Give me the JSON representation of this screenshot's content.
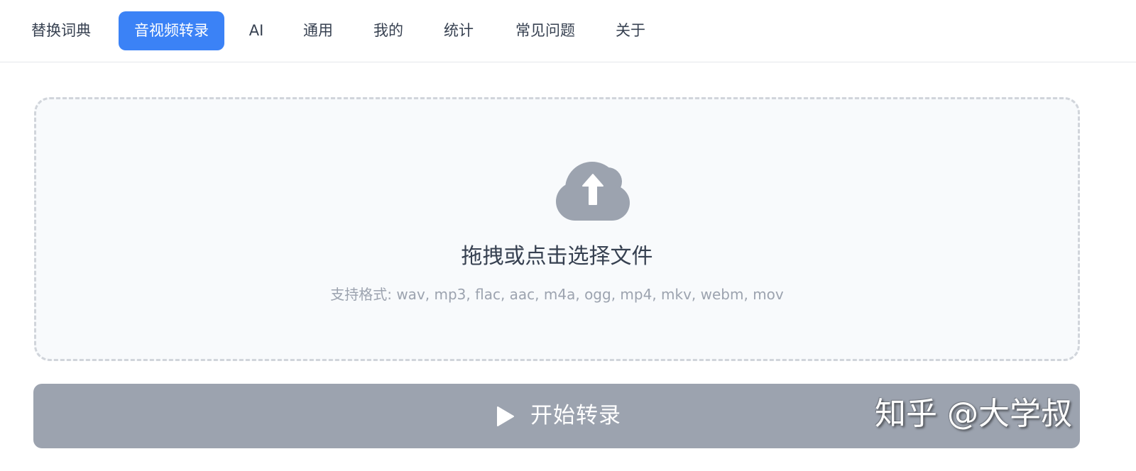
{
  "tabs": [
    {
      "label": "替换词典",
      "active": false
    },
    {
      "label": "音视频转录",
      "active": true
    },
    {
      "label": "AI",
      "active": false
    },
    {
      "label": "通用",
      "active": false
    },
    {
      "label": "我的",
      "active": false
    },
    {
      "label": "统计",
      "active": false
    },
    {
      "label": "常见问题",
      "active": false
    },
    {
      "label": "关于",
      "active": false
    }
  ],
  "upload": {
    "icon": "cloud-upload-icon",
    "title": "拖拽或点击选择文件",
    "formats": "支持格式: wav, mp3, flac, aac, m4a, ogg, mp4, mkv, webm, mov"
  },
  "start_button": {
    "icon": "play-icon",
    "label": "开始转录"
  },
  "watermark": {
    "text": "知乎 @大学叔"
  },
  "colors": {
    "accent": "#3b82f6",
    "button_disabled": "#9ca3af",
    "dropzone_bg": "#f8fafc",
    "dropzone_border": "#d1d5db"
  }
}
